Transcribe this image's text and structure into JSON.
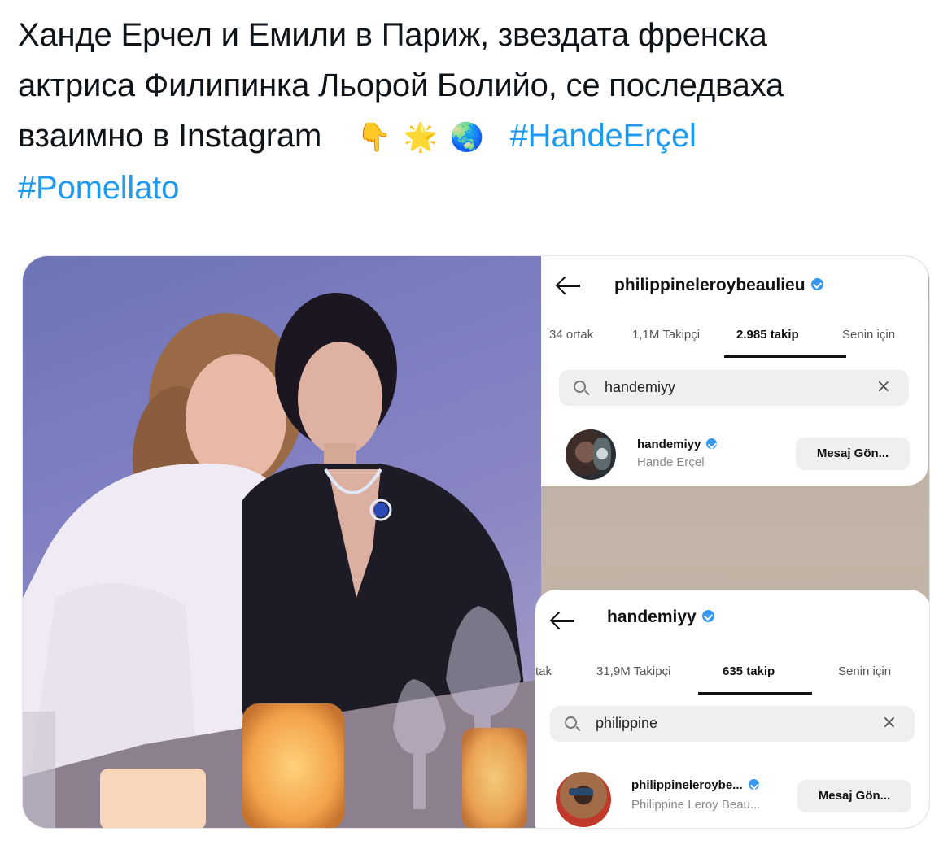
{
  "tweet": {
    "text_line1": "Ханде Ерчел и Емили в Париж, звездата френска",
    "text_line2": "актриса Филипинка Льорой Болийо, се последваха",
    "text_line3_prefix": "взаимно в Instagram",
    "emojis": [
      "👇",
      "🌟",
      "🌏"
    ],
    "hashtags": [
      "#HandeErçel",
      "#Pomellato"
    ]
  },
  "media": {
    "top_card": {
      "username": "philippineleroybeaulieu",
      "tabs": [
        "34 ortak",
        "1,1M Takipçi",
        "2.985 takip",
        "Senin için"
      ],
      "active_tab": "2.985 takip",
      "search_value": "handemiyy",
      "clear_icon": "×",
      "result": {
        "username": "handemiyy",
        "name": "Hande Erçel",
        "button": "Mesaj Gön..."
      }
    },
    "bottom_card": {
      "username": "handemiyy",
      "tabs": [
        "tak",
        "31,9M Takipçi",
        "635 takip",
        "Senin için"
      ],
      "active_tab": "635 takip",
      "search_value": "philippine",
      "clear_icon": "×",
      "result": {
        "username": "philippineleroybe...",
        "name": "Philippine Leroy Beau...",
        "button": "Mesaj Gön..."
      }
    }
  },
  "colors": {
    "text": "#0f1419",
    "hashtag": "#1d9bf0",
    "verified": "#3897f0"
  }
}
